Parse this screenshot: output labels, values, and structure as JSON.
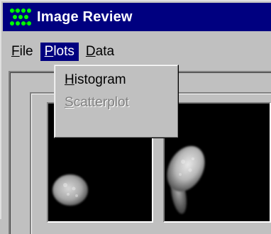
{
  "window": {
    "title": "Image Review",
    "icon": "app-dots-icon"
  },
  "menubar": {
    "items": [
      {
        "label": "File",
        "accel": "F",
        "rest": "ile"
      },
      {
        "label": "Plots",
        "accel": "P",
        "rest": "lots",
        "active": true
      },
      {
        "label": "Data",
        "accel": "D",
        "rest": "ata"
      }
    ]
  },
  "plots_menu": {
    "items": [
      {
        "label": "Histogram",
        "accel": "H",
        "rest": "istogram",
        "enabled": true
      },
      {
        "label": "Scatterplot",
        "accel": "S",
        "rest": "catterplot",
        "enabled": false
      }
    ]
  },
  "images": {
    "left_icon": "cell-image",
    "right_icon": "cell-image"
  },
  "colors": {
    "titlebar": "#000080",
    "face": "#c0c0c0",
    "menu_highlight": "#000080",
    "disabled_text": "#808080",
    "image_bg": "#000000"
  }
}
